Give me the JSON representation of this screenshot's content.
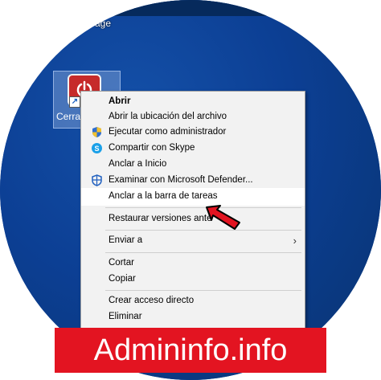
{
  "desktop": {
    "top_label": "age",
    "icon_label": "Cerrar",
    "icon_name": "power-off-icon",
    "accent_color": "#c62a2a"
  },
  "context_menu": {
    "items": [
      {
        "label": "Abrir",
        "bold": true,
        "icon": ""
      },
      {
        "label": "Abrir la ubicación del archivo",
        "icon": ""
      },
      {
        "label": "Ejecutar como administrador",
        "icon": "uac-shield-icon"
      },
      {
        "label": "Compartir con Skype",
        "icon": "skype-icon"
      },
      {
        "label": "Anclar a Inicio",
        "icon": ""
      },
      {
        "label": "Examinar con Microsoft Defender...",
        "icon": "defender-icon"
      },
      {
        "label": "Anclar a la barra de tareas",
        "icon": "",
        "highlighted": true
      },
      {
        "label": "Restaurar versiones ante",
        "icon": ""
      },
      {
        "label": "Enviar a",
        "icon": "",
        "submenu": true
      },
      {
        "label": "Cortar",
        "icon": ""
      },
      {
        "label": "Copiar",
        "icon": ""
      },
      {
        "label": "Crear acceso directo",
        "icon": ""
      },
      {
        "label": "Eliminar",
        "icon": ""
      }
    ]
  },
  "watermark": {
    "text": "Admininfo.info",
    "color": "#e31421"
  }
}
